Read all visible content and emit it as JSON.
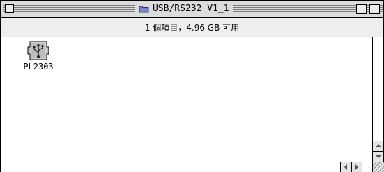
{
  "window": {
    "title": "USB/RS232 V1_1",
    "info": "1 個項目，4.96 GB 可用"
  },
  "items": [
    {
      "label": "PL2303",
      "icon": "usb-driver-icon"
    }
  ],
  "icons": {
    "title": "folder-icon",
    "close": "close-box-icon",
    "zoom": "zoom-box-icon",
    "collapse": "collapse-box-icon"
  }
}
